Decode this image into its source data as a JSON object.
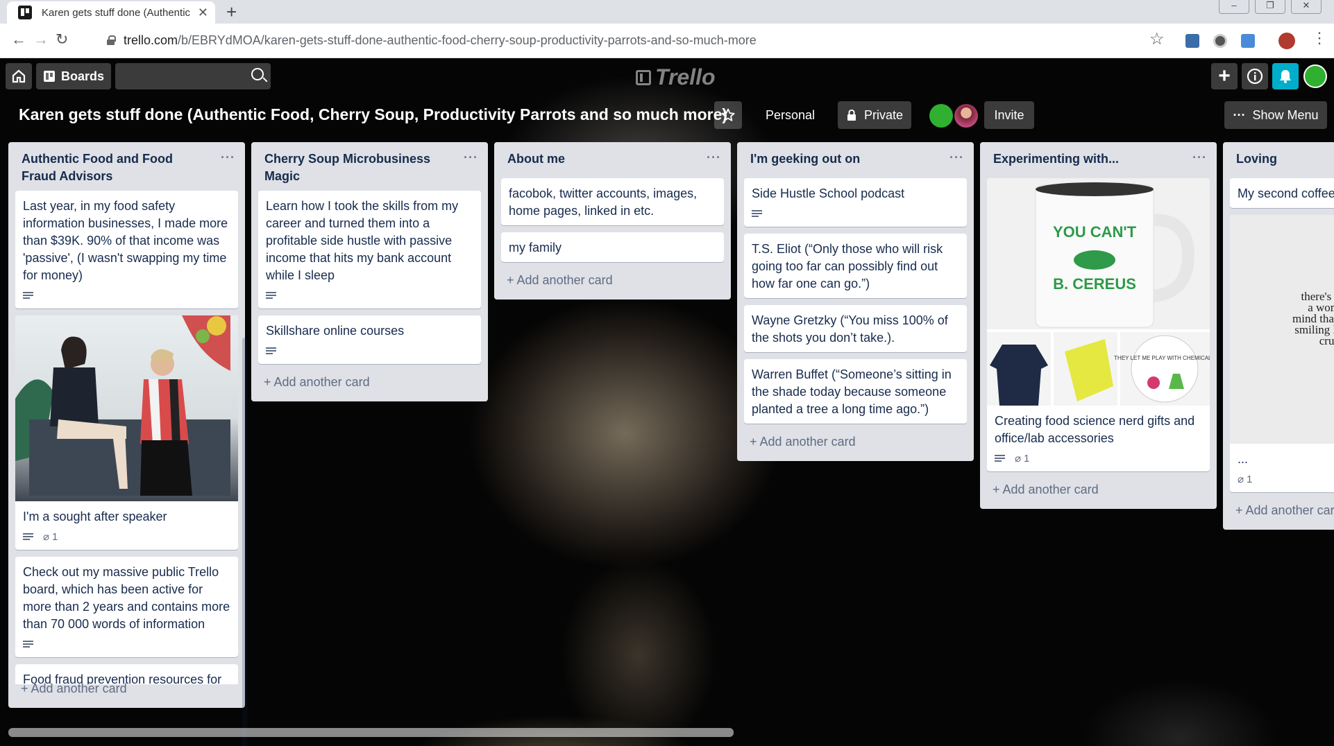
{
  "browser": {
    "tab_title": "Karen gets stuff done (Authentic",
    "url_domain": "trello.com",
    "url_path": "/b/EBRYdMOA/karen-gets-stuff-done-authentic-food-cherry-soup-productivity-parrots-and-so-much-more"
  },
  "topbar": {
    "boards_label": "Boards",
    "logo_text": "Trello",
    "search_placeholder": ""
  },
  "board": {
    "title": "Karen gets stuff done (Authentic Food, Cherry Soup, Productivity Parrots and so much more)",
    "visibility_team": "Personal",
    "visibility_privacy": "Private",
    "invite_label": "Invite",
    "show_menu_label": "Show Menu",
    "accent_color": "#00aecc",
    "list_bg": "#dfe1e6"
  },
  "lists": [
    {
      "title": "Authentic Food and Food Fraud Advisors",
      "add_card": "+ Add another card",
      "cards": [
        {
          "text": "Last year, in my food safety information businesses, I made more than $39K. 90% of that income was 'passive', (I wasn't swapping my time for money)"
        },
        {
          "text": "I'm a sought after speaker",
          "attachments": "1"
        },
        {
          "text": "Check out my massive public Trello board, which has been active for more than 2 years and contains more than 70 000 words of information"
        },
        {
          "text": "Food fraud prevention resources for ..."
        }
      ]
    },
    {
      "title": "Cherry Soup Microbusiness Magic",
      "add_card": "+ Add another card",
      "cards": [
        {
          "text": "Learn how I took the skills from my career and turned them into a profitable side hustle with passive income that hits my bank account while I sleep"
        },
        {
          "text": "Skillshare online courses"
        }
      ]
    },
    {
      "title": "About me",
      "add_card": "+ Add another card",
      "cards": [
        {
          "text": "facobok, twitter accounts, images, home pages, linked in etc."
        },
        {
          "text": "my family"
        }
      ]
    },
    {
      "title": "I'm geeking out on",
      "add_card": "+ Add another card",
      "cards": [
        {
          "text": "Side Hustle School podcast"
        },
        {
          "text": "T.S. Eliot (“Only those who will risk going too far can possibly find out how far one can go.”)"
        },
        {
          "text": "Wayne Gretzky (“You miss 100% of the shots you don’t take.)."
        },
        {
          "text": "Warren Buffet (“Someone’s sitting in the shade today because someone planted a tree a long time ago.”)"
        }
      ]
    },
    {
      "title": "Experimenting with...",
      "add_card": "+ Add another card",
      "cards": [
        {
          "text": "Creating food science nerd gifts and office/lab accessories",
          "attachments": "1",
          "mug_text_1": "YOU CAN'T",
          "mug_text_2": "B. CEREUS",
          "button_text": "THEY LET ME PLAY WITH CHEMICALS"
        }
      ]
    },
    {
      "title": "Loving",
      "add_card": "+ Add another car",
      "cards": [
        {
          "text": "My second coffee"
        },
        {
          "text": "...",
          "attachments": "1",
          "quote_text": "there's so\na woma\nmind that s\nsmiling kn\ncrush"
        }
      ]
    }
  ]
}
